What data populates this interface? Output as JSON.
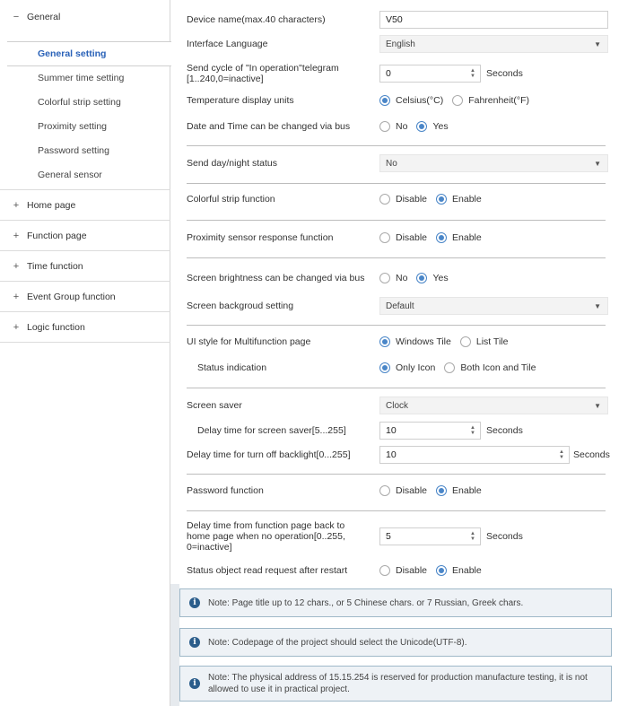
{
  "sidebar": {
    "general": {
      "toggle": "−",
      "label": "General"
    },
    "sub_items": [
      {
        "label": "General setting",
        "active": true
      },
      {
        "label": "Summer time setting"
      },
      {
        "label": "Colorful strip setting"
      },
      {
        "label": "Proximity setting"
      },
      {
        "label": "Password setting"
      },
      {
        "label": "General sensor"
      }
    ],
    "groups": [
      {
        "toggle": "+",
        "label": "Home page"
      },
      {
        "toggle": "+",
        "label": "Function page"
      },
      {
        "toggle": "+",
        "label": "Time function"
      },
      {
        "toggle": "+",
        "label": "Event Group function"
      },
      {
        "toggle": "+",
        "label": "Logic function"
      }
    ]
  },
  "params": {
    "device_name": {
      "label": "Device name(max.40 characters)",
      "value": "V50"
    },
    "interface_language": {
      "label": "Interface Language",
      "value": "English"
    },
    "send_cycle": {
      "label": "Send cycle of \"In operation\"telegram [1..240,0=inactive]",
      "value": "0",
      "unit": "Seconds"
    },
    "temp_units": {
      "label": "Temperature display units",
      "options": [
        "Celsius(°C)",
        "Fahrenheit(°F)"
      ],
      "selected": 0
    },
    "date_time_bus": {
      "label": "Date and Time can be changed via bus",
      "options": [
        "No",
        "Yes"
      ],
      "selected": 1
    },
    "day_night": {
      "label": "Send day/night status",
      "value": "No"
    },
    "colorful_strip": {
      "label": "Colorful strip function",
      "options": [
        "Disable",
        "Enable"
      ],
      "selected": 1
    },
    "proximity": {
      "label": "Proximity sensor response function",
      "options": [
        "Disable",
        "Enable"
      ],
      "selected": 1
    },
    "brightness_bus": {
      "label": "Screen brightness can be changed via bus",
      "options": [
        "No",
        "Yes"
      ],
      "selected": 1
    },
    "background": {
      "label": "Screen backgroud setting",
      "value": "Default"
    },
    "ui_style": {
      "label": "UI style for Multifunction page",
      "options": [
        "Windows Tile",
        "List Tile"
      ],
      "selected": 0
    },
    "status_indication": {
      "label": "Status indication",
      "options": [
        "Only Icon",
        "Both Icon and Tile"
      ],
      "selected": 0
    },
    "screen_saver": {
      "label": "Screen saver",
      "value": "Clock"
    },
    "saver_delay": {
      "label": "Delay time for screen saver[5...255]",
      "value": "10",
      "unit": "Seconds"
    },
    "backlight_delay": {
      "label": "Delay time for turn off backlight[0...255]",
      "value": "10",
      "unit": "Seconds"
    },
    "password": {
      "label": "Password function",
      "options": [
        "Disable",
        "Enable"
      ],
      "selected": 1
    },
    "back_home_delay": {
      "label": "Delay time from function page back to home page when no operation[0..255, 0=inactive]",
      "value": "5",
      "unit": "Seconds"
    },
    "status_read": {
      "label": "Status object read request  after restart",
      "options": [
        "Disable",
        "Enable"
      ],
      "selected": 1
    }
  },
  "notes": [
    "Note: Page title up to 12 chars., or 5 Chinese chars. or 7 Russian, Greek chars.",
    "Note: Codepage of the project should select the Unicode(UTF-8).",
    "Note: The physical address of 15.15.254 is reserved for production manufacture testing, it is not allowed to use it in practical project."
  ],
  "colors": {
    "accent": "#4a86c8",
    "active_text": "#2a62b8",
    "note_bg": "#eef2f6"
  }
}
